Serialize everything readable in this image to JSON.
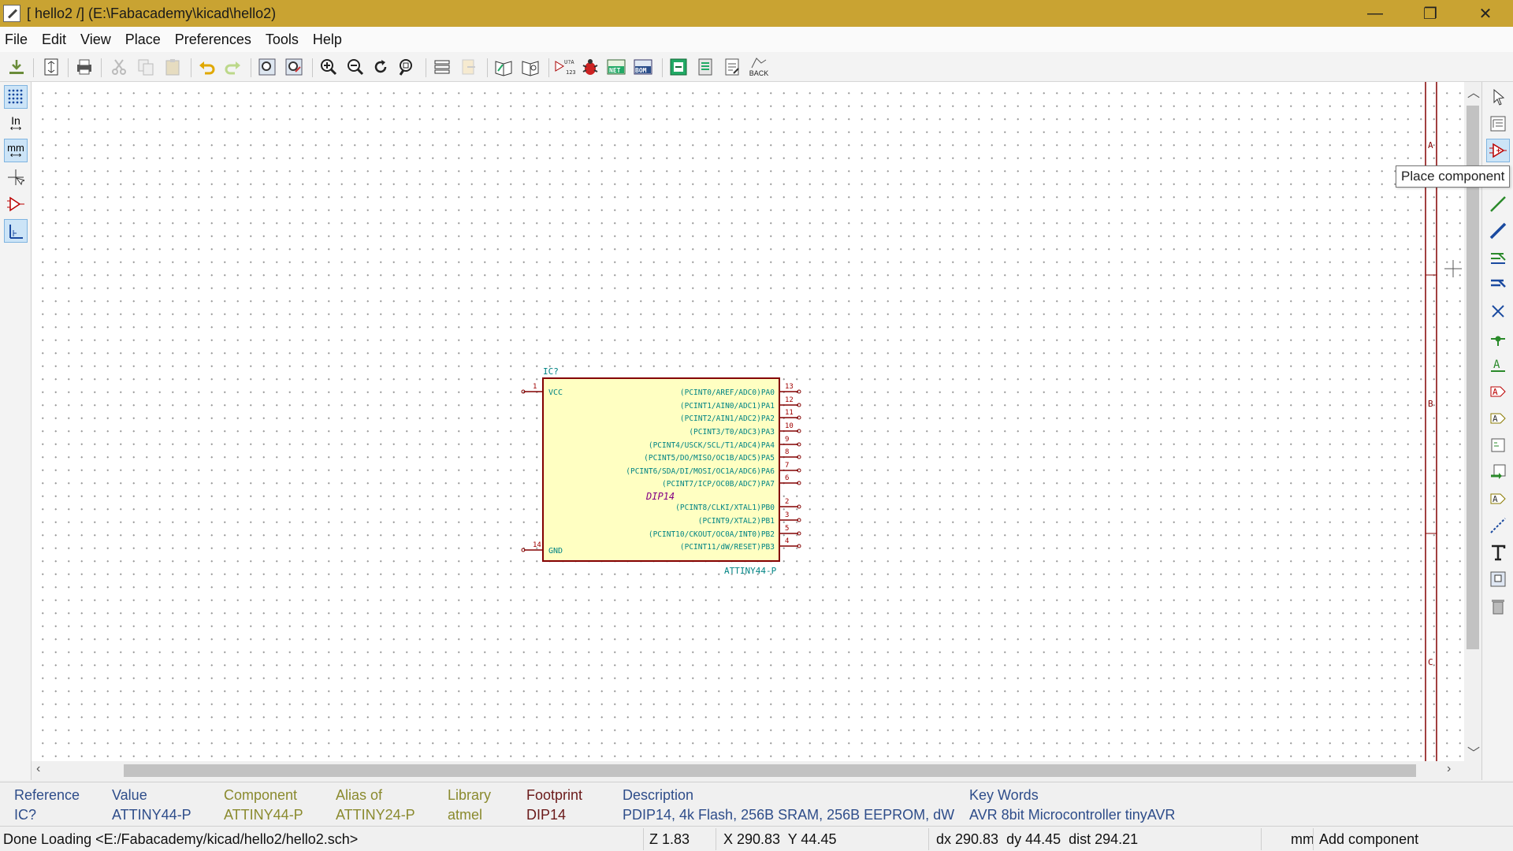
{
  "window": {
    "title": "[ hello2 /] (E:\\Fabacademy\\kicad\\hello2)",
    "minimize": "—",
    "maximize": "❐",
    "close": "✕"
  },
  "menu": [
    "File",
    "Edit",
    "View",
    "Place",
    "Preferences",
    "Tools",
    "Help"
  ],
  "toolbar": {
    "back_label": "BACK",
    "icons": [
      "open-icon",
      "page-settings-icon",
      "print-icon",
      "cut-icon",
      "copy-icon",
      "paste-icon",
      "undo-icon",
      "redo-icon",
      "find-icon",
      "find-replace-icon",
      "zoom-in-icon",
      "zoom-out-icon",
      "redraw-icon",
      "zoom-fit-icon",
      "hierarchy-icon",
      "leave-sheet-icon",
      "library-editor-icon",
      "library-browser-icon",
      "annotate-icon",
      "erc-icon",
      "netlist-icon",
      "bom-icon",
      "cvpcb-icon",
      "pcbnew-icon",
      "import-footprint-icon",
      "back-annotate-icon"
    ]
  },
  "left_toolbar": {
    "inch_label": "In",
    "mm_label": "mm"
  },
  "tooltip": "Place component",
  "schematic": {
    "reference": "IC?",
    "value": "ATTINY44-P",
    "footprint": "DIP14",
    "left_pins": [
      {
        "num": "1",
        "name": "VCC"
      },
      {
        "num": "14",
        "name": "GND"
      }
    ],
    "right_pins": [
      {
        "num": "13",
        "name": "(PCINT0/AREF/ADC0)PA0"
      },
      {
        "num": "12",
        "name": "(PCINT1/AIN0/ADC1)PA1"
      },
      {
        "num": "11",
        "name": "(PCINT2/AIN1/ADC2)PA2"
      },
      {
        "num": "10",
        "name": "(PCINT3/T0/ADC3)PA3"
      },
      {
        "num": "9",
        "name": "(PCINT4/USCK/SCL/T1/ADC4)PA4"
      },
      {
        "num": "8",
        "name": "(PCINT5/DO/MISO/OC1B/ADC5)PA5"
      },
      {
        "num": "7",
        "name": "(PCINT6/SDA/DI/MOSI/OC1A/ADC6)PA6"
      },
      {
        "num": "6",
        "name": "(PCINT7/ICP/OC0B/ADC7)PA7"
      },
      {
        "num": "2",
        "name": "(PCINT8/CLKI/XTAL1)PB0"
      },
      {
        "num": "3",
        "name": "(PCINT9/XTAL2)PB1"
      },
      {
        "num": "5",
        "name": "(PCINT10/CKOUT/OC0A/INT0)PB2"
      },
      {
        "num": "4",
        "name": "(PCINT11/dW/RESET)PB3"
      }
    ],
    "border_zones": [
      "A",
      "B",
      "C"
    ]
  },
  "info": {
    "reference": {
      "label": "Reference",
      "value": "IC?"
    },
    "value": {
      "label": "Value",
      "value": "ATTINY44-P"
    },
    "component": {
      "label": "Component",
      "value": "ATTINY44-P"
    },
    "alias_of": {
      "label": "Alias of",
      "value": "ATTINY24-P"
    },
    "library": {
      "label": "Library",
      "value": "atmel"
    },
    "footprint": {
      "label": "Footprint",
      "value": "DIP14"
    },
    "description": {
      "label": "Description",
      "value": "PDIP14, 4k Flash, 256B SRAM, 256B EEPROM, dW"
    },
    "key_words": {
      "label": "Key Words",
      "value": "AVR 8bit Microcontroller tinyAVR"
    }
  },
  "status": {
    "message": "Done Loading <E:/Fabacademy/kicad/hello2/hello2.sch>",
    "zoom": "Z 1.83",
    "xy": "X 290.83  Y 44.45",
    "delta": "dx 290.83  dy 44.45  dist 294.21",
    "units": "mm",
    "mode": "Add component"
  },
  "colors": {
    "titlebar": "#c9a332",
    "component_body": "#ffffc2",
    "component_outline": "#840000",
    "pin_text": "#008484",
    "pin_number": "#a00000"
  }
}
